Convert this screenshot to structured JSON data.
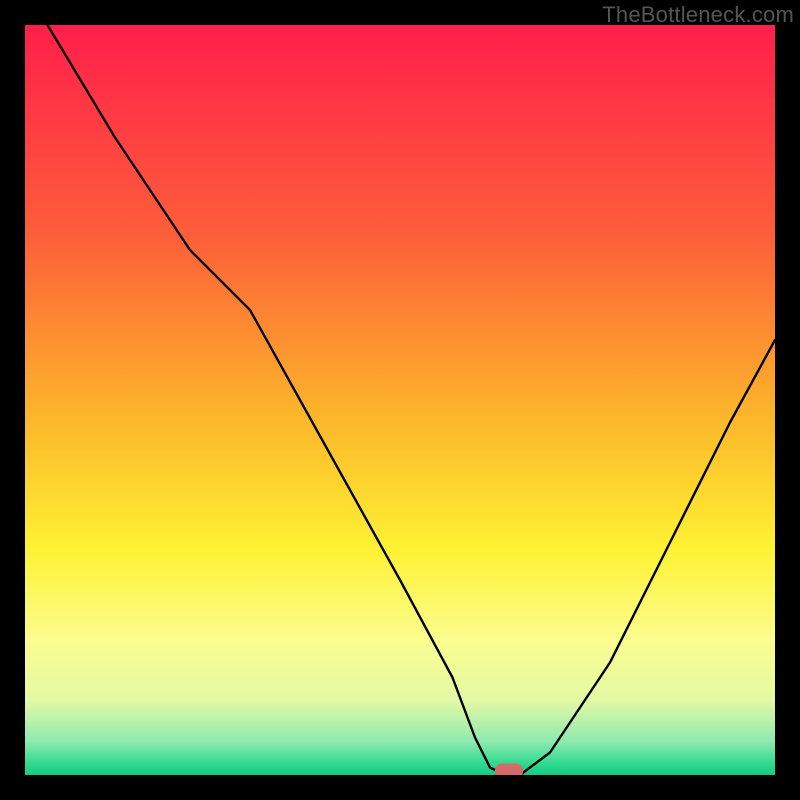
{
  "watermark": "TheBottleneck.com",
  "chart_data": {
    "type": "line",
    "title": "",
    "xlabel": "",
    "ylabel": "",
    "xlim": [
      0,
      100
    ],
    "ylim": [
      0,
      100
    ],
    "x": [
      3,
      12,
      22,
      30,
      40,
      50,
      57,
      60,
      62,
      64,
      66,
      70,
      78,
      86,
      94,
      100
    ],
    "values": [
      100,
      85,
      70,
      62,
      44,
      26,
      13,
      5,
      1,
      0,
      0,
      3,
      15,
      31,
      47,
      58
    ],
    "gradient_stops": [
      {
        "pos": 0.0,
        "color": "#ff1f4b"
      },
      {
        "pos": 0.28,
        "color": "#fd5e3a"
      },
      {
        "pos": 0.52,
        "color": "#fcb52a"
      },
      {
        "pos": 0.7,
        "color": "#fef233"
      },
      {
        "pos": 0.82,
        "color": "#fbfd8f"
      },
      {
        "pos": 0.9,
        "color": "#e4f9a4"
      },
      {
        "pos": 0.955,
        "color": "#8feab0"
      },
      {
        "pos": 0.985,
        "color": "#2fd98f"
      },
      {
        "pos": 1.0,
        "color": "#18c983"
      }
    ],
    "marker": {
      "x": 64.5,
      "y": 0.5,
      "color": "#d46a6a"
    }
  }
}
